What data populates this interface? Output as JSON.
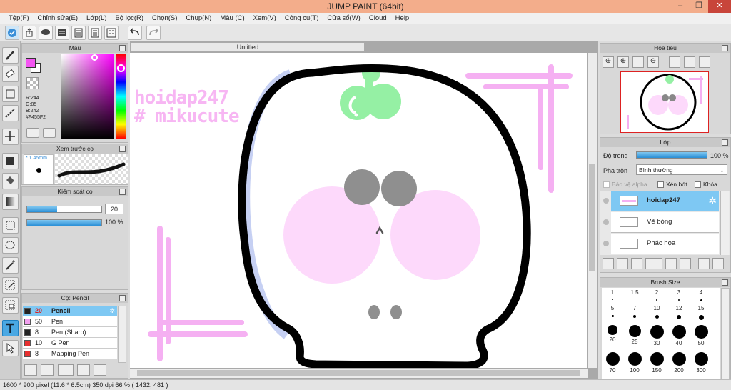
{
  "window": {
    "title": "JUMP PAINT (64bit)"
  },
  "menu": [
    "Tệp(F)",
    "Chỉnh sửa(E)",
    "Lớp(L)",
    "Bộ lọc(R)",
    "Chọn(S)",
    "Chụp(N)",
    "Màu (C)",
    "Xem(V)",
    "Công cụ(T)",
    "Cửa sổ(W)",
    "Cloud",
    "Help"
  ],
  "color_panel": {
    "title": "Màu",
    "r": "R:244",
    "g": "G:85",
    "b": "B:242",
    "hex": "#F455F2",
    "main_color": "#F455F2"
  },
  "preview_panel": {
    "title": "Xem trước cọ",
    "size": "* 1.45mm"
  },
  "control_panel": {
    "title": "Kiểm soát cọ",
    "size_value": "20",
    "opacity_value": "100 %",
    "opacity_level": 1.0
  },
  "brush_panel": {
    "title": "Cọ: Pencil",
    "items": [
      {
        "size": "20",
        "name": "Pencil",
        "color": "#222222",
        "selected": true
      },
      {
        "size": "50",
        "name": "Pen",
        "color": "#f2a0ef",
        "selected": false
      },
      {
        "size": "8",
        "name": "Pen (Sharp)",
        "color": "#222222",
        "selected": false
      },
      {
        "size": "10",
        "name": "G Pen",
        "color": "#e63030",
        "selected": false
      },
      {
        "size": "8",
        "name": "Mapping Pen",
        "color": "#e63030",
        "selected": false
      }
    ]
  },
  "canvas": {
    "tab": "Untitled",
    "text1": "hoidap247",
    "text2": "# mikucute"
  },
  "navigator": {
    "title": "Hoa tiêu"
  },
  "layer_panel": {
    "title": "Lớp",
    "opacity_label": "Độ trong",
    "opacity_value": "100 %",
    "blend_label": "Pha trộn",
    "blend_value": "Bình thường",
    "protect_alpha": "Bảo vệ alpha",
    "clip": "Xén bớt",
    "lock": "Khóa",
    "layers": [
      {
        "name": "hoidap247",
        "selected": true
      },
      {
        "name": "Vẽ bóng",
        "selected": false
      },
      {
        "name": "Phác họa",
        "selected": false
      }
    ]
  },
  "brush_size_panel": {
    "title": "Brush Size",
    "row1": [
      "1",
      "1.5",
      "2",
      "3",
      "4"
    ],
    "row2": [
      "5",
      "7",
      "10",
      "12",
      "15"
    ],
    "row3": [
      "20",
      "25",
      "30",
      "40",
      "50"
    ],
    "row4": [
      "70",
      "100",
      "150",
      "200",
      "300"
    ]
  },
  "status": {
    "text": "1600 * 900 pixel  (11.6 * 6.5cm)  350 dpi  66 %  ( 1432, 481 )"
  }
}
